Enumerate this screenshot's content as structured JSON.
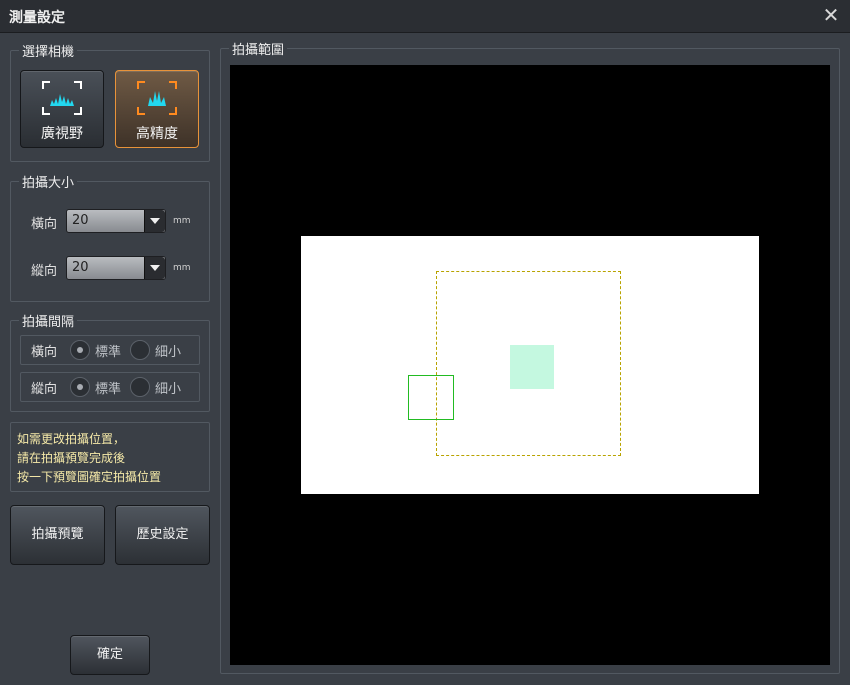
{
  "window": {
    "title": "測量設定",
    "close_glyph": "✕"
  },
  "left": {
    "select_camera": {
      "legend": "選擇相機",
      "modes": [
        {
          "label": "廣視野",
          "icon": "wide-view-icon",
          "active": false
        },
        {
          "label": "高精度",
          "icon": "high-precision-icon",
          "active": true
        }
      ]
    },
    "capture_size": {
      "legend": "拍攝大小",
      "horizontal": {
        "label": "橫向",
        "value": "20",
        "unit": "mm"
      },
      "vertical": {
        "label": "縱向",
        "value": "20",
        "unit": "mm"
      }
    },
    "capture_interval": {
      "legend": "拍攝間隔",
      "rows": [
        {
          "label": "橫向",
          "option_standard": "標準",
          "option_fine": "細小",
          "selected": "標準"
        },
        {
          "label": "縱向",
          "option_standard": "標準",
          "option_fine": "細小",
          "selected": "標準"
        }
      ]
    },
    "note_lines": [
      "如需更改拍攝位置，",
      "請在拍攝預覽完成後",
      "按一下預覽圖確定拍攝位置"
    ],
    "preview_button": "拍攝預覽",
    "history_button": "歷史設定",
    "ok_button": "確定"
  },
  "capture_range": {
    "legend": "拍攝範圍"
  },
  "colors": {
    "accent_orange": "#e8933a",
    "icon_cyan": "#22d8f0",
    "range_dashed": "#b8a300",
    "target_fill": "#c4f8e0",
    "cursor_green": "#22bb22"
  }
}
